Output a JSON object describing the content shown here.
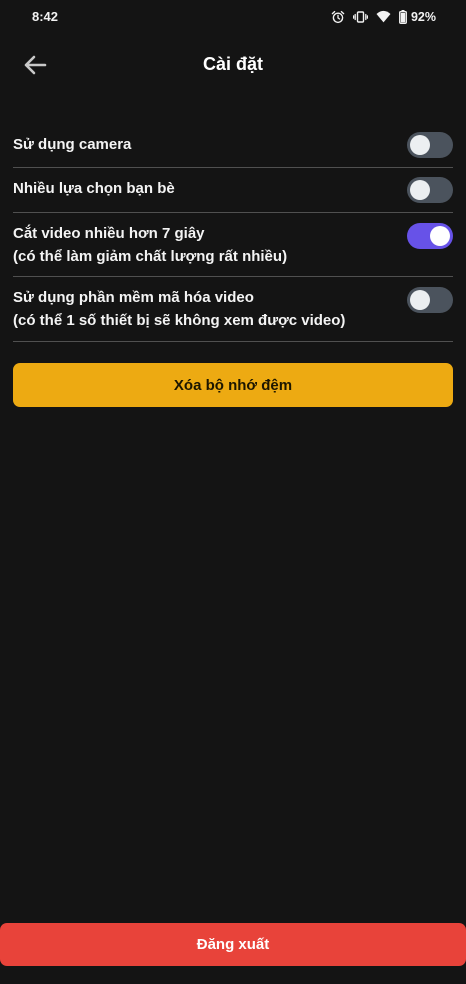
{
  "status_bar": {
    "time": "8:42",
    "battery": "92%",
    "icons": [
      "alarm-icon",
      "vibrate-icon",
      "wifi-icon",
      "battery-icon"
    ]
  },
  "header": {
    "back_icon": "arrow-left-icon",
    "title": "Cài đặt"
  },
  "settings": [
    {
      "line1": "Sử dụng camera",
      "line2": "",
      "enabled": false
    },
    {
      "line1": "Nhiều lựa chọn bạn bè",
      "line2": "",
      "enabled": false
    },
    {
      "line1": "Cắt video nhiều hơn 7 giây",
      "line2": "(có thể làm giảm chất lượng rất nhiều)",
      "enabled": true
    },
    {
      "line1": "Sử dụng phần mềm mã hóa video",
      "line2": "(có thể 1 số thiết bị sẽ không xem được video)",
      "enabled": false
    }
  ],
  "clear_cache_label": "Xóa bộ nhớ đệm",
  "logout_label": "Đăng xuất",
  "colors": {
    "background": "#141414",
    "toggle_on": "#6752e8",
    "toggle_off": "#4b535d",
    "clear_cache": "#edaa12",
    "logout": "#e8433a"
  }
}
